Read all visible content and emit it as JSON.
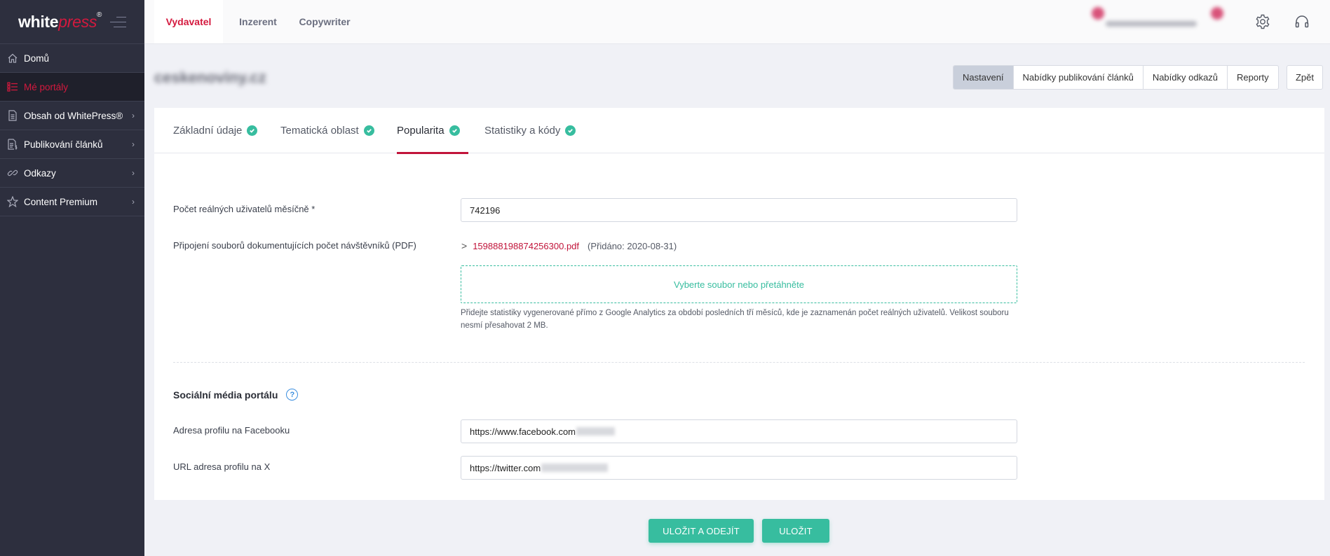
{
  "sidebar": {
    "logo": {
      "white": "white",
      "colored": "press",
      "mark": "®"
    },
    "items": [
      {
        "label": "Domů",
        "icon": "home-icon",
        "active": false,
        "has_submenu": false
      },
      {
        "label": "Mé portály",
        "icon": "list-icon",
        "active": true,
        "has_submenu": false
      },
      {
        "label": "Obsah od WhitePress®",
        "icon": "document-icon",
        "active": false,
        "has_submenu": true
      },
      {
        "label": "Publikování článků",
        "icon": "document-dollar-icon",
        "active": false,
        "has_submenu": true
      },
      {
        "label": "Odkazy",
        "icon": "link-icon",
        "active": false,
        "has_submenu": true
      },
      {
        "label": "Content Premium",
        "icon": "star-icon",
        "active": false,
        "has_submenu": true
      }
    ],
    "chevron": "›"
  },
  "topbar": {
    "tabs": [
      {
        "label": "Vydavatel",
        "active": true
      },
      {
        "label": "Inzerent",
        "active": false
      },
      {
        "label": "Copywriter",
        "active": false
      }
    ]
  },
  "header": {
    "title": "ceskenoviny.cz",
    "nav_buttons": [
      "Nastavení",
      "Nabídky publikování článků",
      "Nabídky odkazů",
      "Reporty"
    ],
    "back_label": "Zpět"
  },
  "tabs": [
    {
      "label": "Základní údaje",
      "complete": true,
      "active": false
    },
    {
      "label": "Tematická oblast",
      "complete": true,
      "active": false
    },
    {
      "label": "Popularita",
      "complete": true,
      "active": true
    },
    {
      "label": "Statistiky a kódy",
      "complete": true,
      "active": false
    }
  ],
  "form": {
    "monthly_users": {
      "label": "Počet reálných uživatelů měsíčně *",
      "value": "742196"
    },
    "attachment": {
      "label": "Připojení souborů dokumentujících počet návštěvníků (PDF)",
      "file_name": "159888198874256300.pdf",
      "added": "(Přidáno: 2020-08-31)",
      "dropzone_text": "Vyberte soubor nebo přetáhněte",
      "hint": "Přidejte statistiky vygenerované přímo z Google Analytics za období posledních tří měsíců, kde je zaznamenán počet reálných uživatelů. Velikost souboru nesmí přesahovat 2 MB."
    },
    "social_section_title": "Sociální média portálu",
    "help_glyph": "?",
    "facebook": {
      "label": "Adresa profilu na Facebooku",
      "value": "https://www.facebook.com"
    },
    "twitter": {
      "label": "URL adresa profilu na X",
      "value": "https://twitter.com"
    }
  },
  "footer": {
    "save_exit_label": "ULOŽIT A ODEJÍT",
    "save_label": "ULOŽIT"
  },
  "colors": {
    "accent": "#d4193e",
    "success": "#37bd9f",
    "sidebar_bg": "#2d2f3e",
    "help": "#3b8fe0"
  }
}
